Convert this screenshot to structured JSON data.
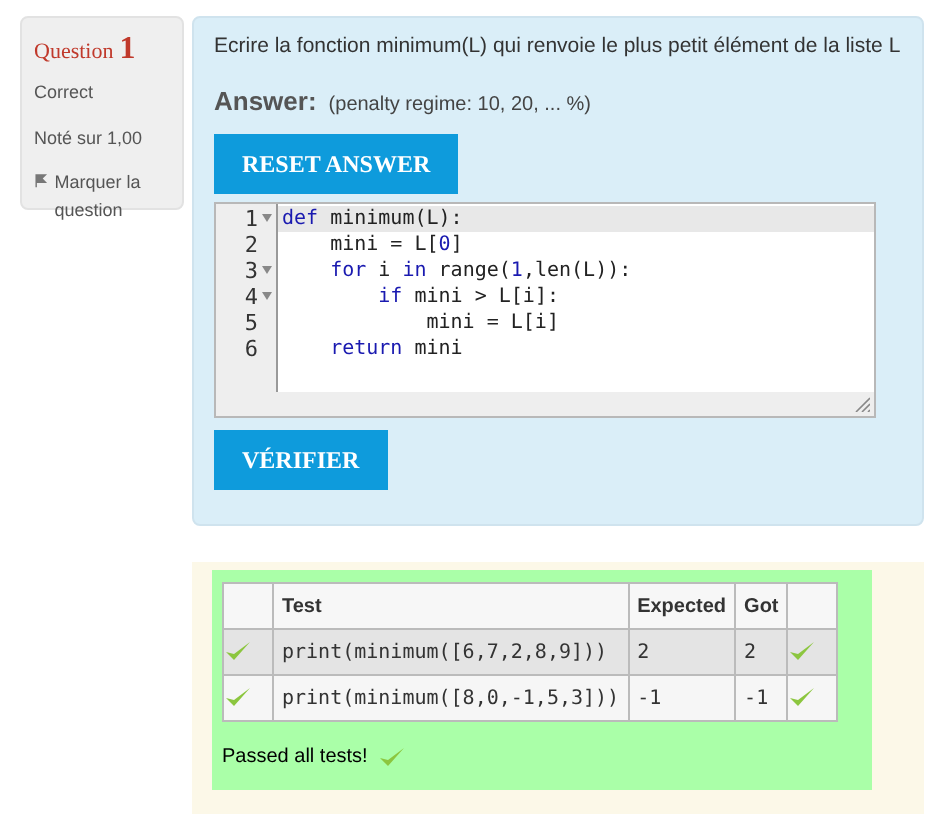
{
  "info": {
    "label": "Question",
    "number": "1",
    "status": "Correct",
    "grade": "Noté sur 1,00",
    "flag": "Marquer la question"
  },
  "question": {
    "text": "Ecrire la fonction minimum(L) qui renvoie le plus petit élément de la liste L",
    "answer_label": "Answer:",
    "penalty": "(penalty regime: 10, 20, ... %)",
    "reset_button": "RESET ANSWER",
    "check_button": "VÉRIFIER"
  },
  "editor": {
    "lines": [
      {
        "number": "1",
        "fold": true,
        "tokens": [
          {
            "kind": "keyword",
            "text": "def"
          },
          {
            "kind": "plain",
            "text": " minimum(L):"
          }
        ]
      },
      {
        "number": "2",
        "fold": false,
        "tokens": [
          {
            "kind": "plain",
            "text": "    mini = L["
          },
          {
            "kind": "number",
            "text": "0"
          },
          {
            "kind": "plain",
            "text": "]"
          }
        ]
      },
      {
        "number": "3",
        "fold": true,
        "tokens": [
          {
            "kind": "keyword",
            "text": "    for"
          },
          {
            "kind": "plain",
            "text": " i "
          },
          {
            "kind": "keyword",
            "text": "in"
          },
          {
            "kind": "plain",
            "text": " range("
          },
          {
            "kind": "number",
            "text": "1"
          },
          {
            "kind": "plain",
            "text": ",len(L)):"
          }
        ]
      },
      {
        "number": "4",
        "fold": true,
        "tokens": [
          {
            "kind": "keyword",
            "text": "        if"
          },
          {
            "kind": "plain",
            "text": " mini > L[i]:"
          }
        ]
      },
      {
        "number": "5",
        "fold": false,
        "tokens": [
          {
            "kind": "plain",
            "text": "            mini = L[i]"
          }
        ]
      },
      {
        "number": "6",
        "fold": false,
        "tokens": [
          {
            "kind": "keyword",
            "text": "    return"
          },
          {
            "kind": "plain",
            "text": " mini"
          }
        ]
      }
    ]
  },
  "results": {
    "columns": [
      "Test",
      "Expected",
      "Got"
    ],
    "rows": [
      {
        "test": "print(minimum([6,7,2,8,9]))",
        "expected": "2",
        "got": "2",
        "passed": true
      },
      {
        "test": "print(minimum([8,0,-1,5,3]))",
        "expected": "-1",
        "got": "-1",
        "passed": true
      }
    ],
    "summary": "Passed all tests!",
    "all_passed": true
  }
}
